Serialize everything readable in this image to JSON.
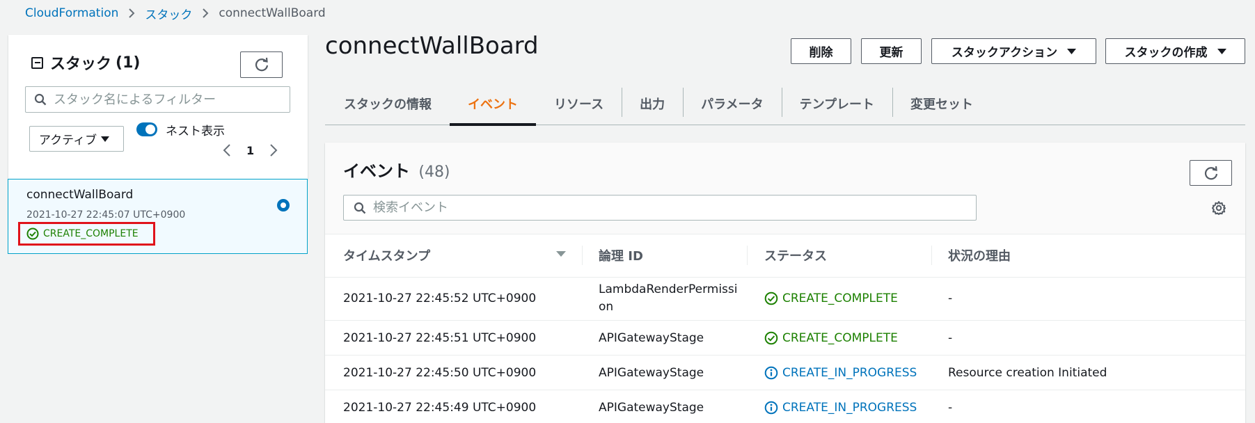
{
  "breadcrumb": {
    "root": "CloudFormation",
    "section": "スタック",
    "current": "connectWallBoard"
  },
  "sidebar": {
    "title": "スタック",
    "count": "(1)",
    "filter_placeholder": "スタック名によるフィルター",
    "status_filter": "アクティブ",
    "nested_toggle_label": "ネスト表示",
    "nested_toggle_on": true,
    "page": "1",
    "stacks": [
      {
        "name": "connectWallBoard",
        "created": "2021-10-27 22:45:07 UTC+0900",
        "status": "CREATE_COMPLETE",
        "selected": true
      }
    ]
  },
  "header": {
    "title": "connectWallBoard",
    "buttons": {
      "delete": "削除",
      "update": "更新",
      "stack_actions": "スタックアクション",
      "create_stack": "スタックの作成"
    }
  },
  "tabs": [
    {
      "label": "スタックの情報",
      "active": false
    },
    {
      "label": "イベント",
      "active": true
    },
    {
      "label": "リソース",
      "active": false
    },
    {
      "label": "出力",
      "active": false
    },
    {
      "label": "パラメータ",
      "active": false
    },
    {
      "label": "テンプレート",
      "active": false
    },
    {
      "label": "変更セット",
      "active": false
    }
  ],
  "events": {
    "title": "イベント",
    "count": "(48)",
    "search_placeholder": "検索イベント",
    "columns": [
      "タイムスタンプ",
      "論理 ID",
      "ステータス",
      "状況の理由"
    ],
    "rows": [
      {
        "timestamp": "2021-10-27 22:45:52 UTC+0900",
        "logical_id_1": "LambdaRenderPermissi",
        "logical_id_2": "on",
        "status": "CREATE_COMPLETE",
        "status_type": "complete",
        "reason": "-"
      },
      {
        "timestamp": "2021-10-27 22:45:51 UTC+0900",
        "logical_id_1": "APIGatewayStage",
        "logical_id_2": "",
        "status": "CREATE_COMPLETE",
        "status_type": "complete",
        "reason": "-"
      },
      {
        "timestamp": "2021-10-27 22:45:50 UTC+0900",
        "logical_id_1": "APIGatewayStage",
        "logical_id_2": "",
        "status": "CREATE_IN_PROGRESS",
        "status_type": "progress",
        "reason": "Resource creation Initiated"
      },
      {
        "timestamp": "2021-10-27 22:45:49 UTC+0900",
        "logical_id_1": "APIGatewayStage",
        "logical_id_2": "",
        "status": "CREATE_IN_PROGRESS",
        "status_type": "progress",
        "reason": "-"
      }
    ]
  },
  "colors": {
    "link": "#0073bb",
    "success": "#1d8102",
    "active_tab": "#ec7211",
    "highlight_box": "#e0131b"
  },
  "icons": {
    "refresh": "refresh-icon",
    "search": "search-icon",
    "settings": "gear-icon",
    "success": "check-circle-icon",
    "in_progress": "info-circle-icon"
  }
}
